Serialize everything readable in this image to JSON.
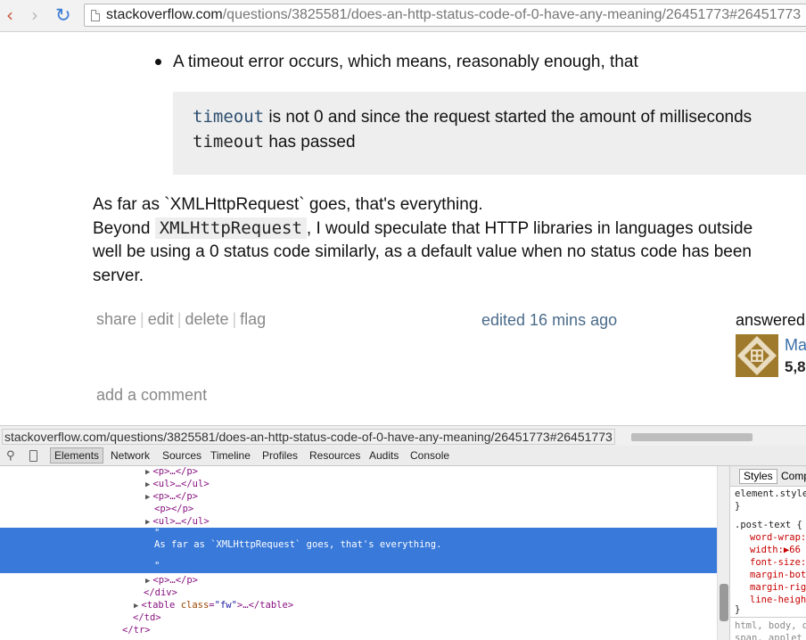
{
  "browser": {
    "back_icon": "‹",
    "forward_icon": "›",
    "reload_icon": "↻",
    "url_host": "stackoverflow.com",
    "url_path": "/questions/3825581/does-an-http-status-code-of-0-have-any-meaning/26451773#26451773"
  },
  "post": {
    "bullet_text": "A timeout error occurs, which means, reasonably enough, that",
    "quote": {
      "line1_code": "timeout",
      "line1_text": " is not 0 and since the request started the amount of milliseconds",
      "line2_code": "timeout",
      "line2_text": " has passed"
    },
    "para1": "As far as `XMLHttpRequest` goes, that's everything.",
    "para2_before": "Beyond ",
    "para2_code": "XMLHttpRequest",
    "para2_after": ", I would speculate that HTTP libraries in languages outside",
    "para3": "well be using a 0 status code similarly, as a default value when no status code has been",
    "para4": "server.",
    "menu": {
      "share": "share",
      "edit": "edit",
      "delete": "delete",
      "flag": "flag",
      "separator": "|"
    },
    "edited": "edited 16 mins ago",
    "answered": "answered",
    "user_name": "Ma",
    "user_rep": "5,8",
    "add_comment": "add a comment"
  },
  "status_bar": {
    "url": "stackoverflow.com/questions/3825581/does-an-http-status-code-of-0-have-any-meaning/26451773#26451773"
  },
  "devtools": {
    "tabs": [
      "Elements",
      "Network",
      "Sources",
      "Timeline",
      "Profiles",
      "Resources",
      "Audits",
      "Console"
    ],
    "nodes": {
      "p1": "<p>…</p>",
      "ul1": "<ul>…</ul>",
      "p2": "<p>…</p>",
      "p_empty": "<p></p>",
      "ul2": "<ul>…</ul>",
      "quote_open": "\"",
      "text_node": "As far as `XMLHttpRequest` goes, that's everything.",
      "quote_close": "\"",
      "p3": "<p>…</p>",
      "div_close": "</div>",
      "table_open": "<table ",
      "table_attr": "class",
      "table_eq": "=",
      "table_val": "\"fw\"",
      "table_rest": ">…</table>",
      "td_close": "</td>",
      "tr_close": "</tr>"
    },
    "styles": {
      "tab_styles": "Styles",
      "tab_computed": "Comp",
      "element_style": "element.style",
      "brace_close": "}",
      "rule_selector": ".post-text {",
      "props": [
        "word-wrap:",
        "width:▶66",
        "font-size:",
        "margin-bot",
        "margin-rig",
        "line-heigh"
      ],
      "ua_line1": "html, body, d",
      "ua_line2": "span, applet"
    }
  },
  "colors": {
    "selection": "#3879d9",
    "link_blue": "#3a6fa8",
    "code_bg": "#eeeeee"
  }
}
